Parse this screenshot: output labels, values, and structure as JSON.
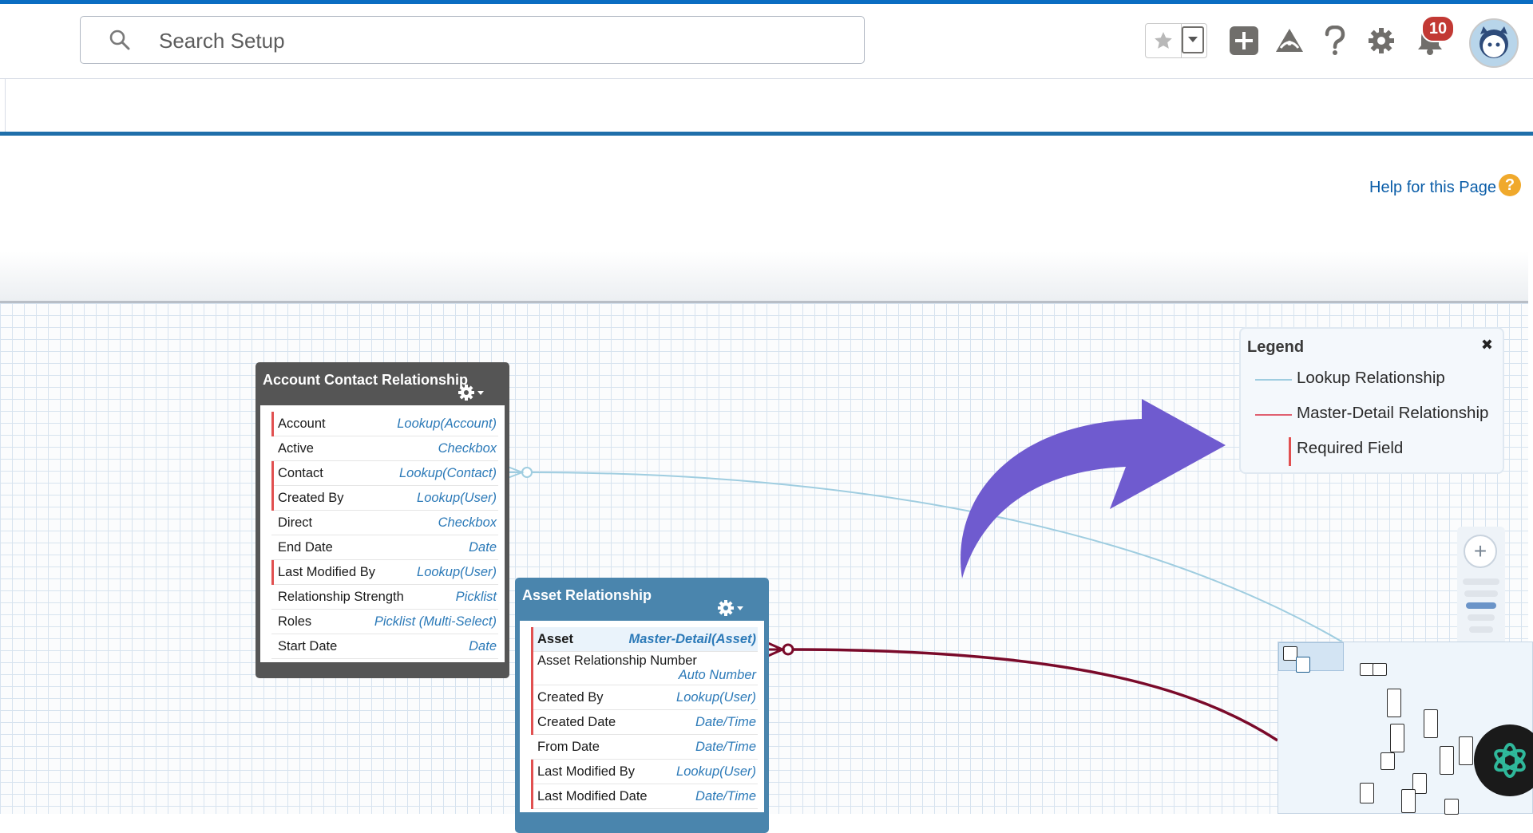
{
  "header": {
    "search_placeholder": "Search Setup",
    "notification_count": "10",
    "icons": [
      "search-icon",
      "star-icon",
      "chevron-down-icon",
      "add-icon",
      "trailhead-icon",
      "help-icon",
      "gear-icon",
      "bell-icon",
      "avatar"
    ]
  },
  "page": {
    "help_link": "Help for this Page",
    "help_badge": "?"
  },
  "legend": {
    "title": "Legend",
    "close": "✖",
    "items": [
      {
        "label": "Lookup Relationship",
        "color": "#9fcde0"
      },
      {
        "label": "Master-Detail Relationship",
        "color": "#e06070"
      },
      {
        "label": "Required Field",
        "color": "#e15050"
      }
    ]
  },
  "objects": [
    {
      "title": "Account Contact Relationship",
      "fields": [
        {
          "name": "Account",
          "type": "Lookup(Account)",
          "required": true
        },
        {
          "name": "Active",
          "type": "Checkbox",
          "required": false
        },
        {
          "name": "Contact",
          "type": "Lookup(Contact)",
          "required": true
        },
        {
          "name": "Created By",
          "type": "Lookup(User)",
          "required": true
        },
        {
          "name": "Direct",
          "type": "Checkbox",
          "required": false
        },
        {
          "name": "End Date",
          "type": "Date",
          "required": false
        },
        {
          "name": "Last Modified By",
          "type": "Lookup(User)",
          "required": true
        },
        {
          "name": "Relationship Strength",
          "type": "Picklist",
          "required": false
        },
        {
          "name": "Roles",
          "type": "Picklist (Multi-Select)",
          "required": false
        },
        {
          "name": "Start Date",
          "type": "Date",
          "required": false
        }
      ]
    },
    {
      "title": "Asset Relationship",
      "fields": [
        {
          "name": "Asset",
          "type": "Master-Detail(Asset)",
          "required": true
        },
        {
          "name": "Asset Relationship Number",
          "type": "Auto Number",
          "required": true
        },
        {
          "name": "Created By",
          "type": "Lookup(User)",
          "required": true
        },
        {
          "name": "Created Date",
          "type": "Date/Time",
          "required": true
        },
        {
          "name": "From Date",
          "type": "Date/Time",
          "required": false
        },
        {
          "name": "Last Modified By",
          "type": "Lookup(User)",
          "required": true
        },
        {
          "name": "Last Modified Date",
          "type": "Date/Time",
          "required": true
        }
      ]
    }
  ],
  "colors": {
    "brand": "#0a6dc2",
    "lookup_line": "#9fcde0",
    "master_detail_line": "#7a0a2a",
    "required_marker": "#e15050",
    "annotation_arrow": "#6f5bcf"
  }
}
